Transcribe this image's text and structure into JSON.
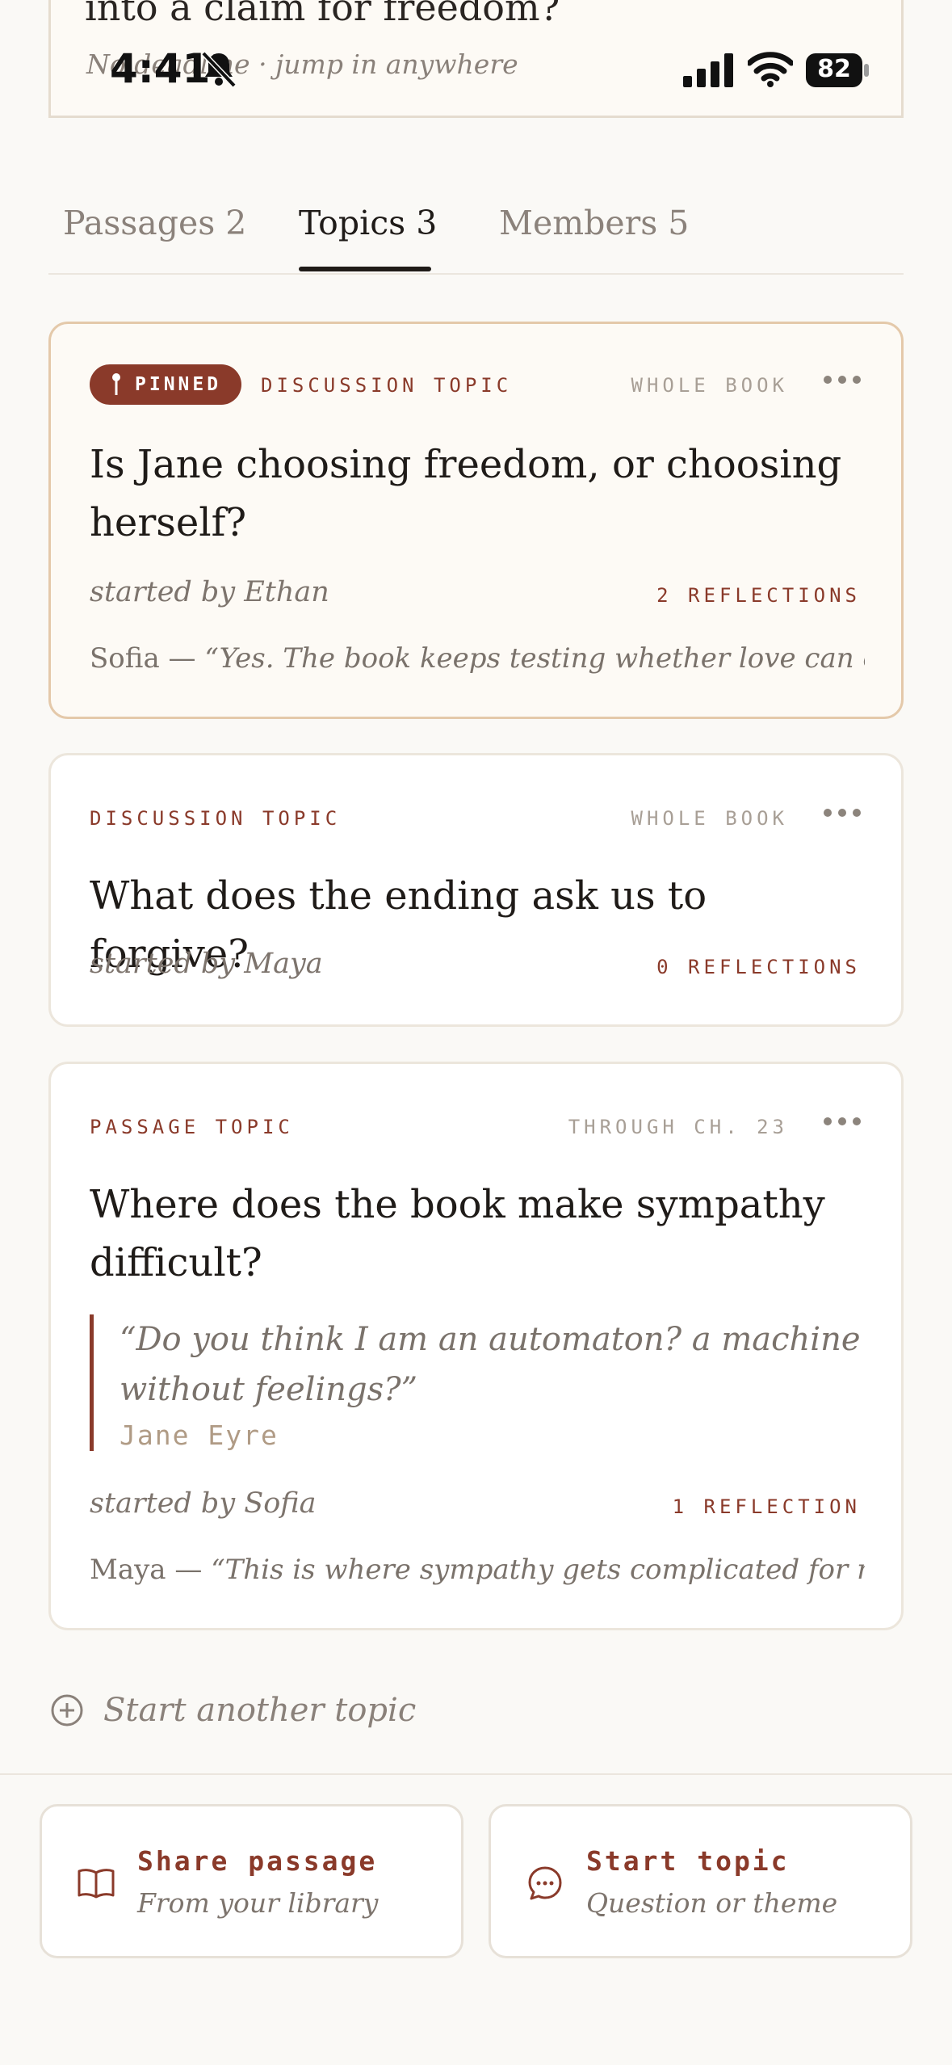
{
  "header_card": {
    "title": "into a claim for freedom?",
    "subtitle": "No deadline · jump in anywhere"
  },
  "status_bar": {
    "time": "4:41",
    "battery": "82"
  },
  "tabs": [
    {
      "label": "Passages 2",
      "active": false
    },
    {
      "label": "Topics 3",
      "active": true
    },
    {
      "label": "Members 5",
      "active": false
    }
  ],
  "topics": [
    {
      "pinned_label": "PINNED",
      "type": "DISCUSSION TOPIC",
      "scope": "WHOLE BOOK",
      "title": "Is Jane choosing freedom, or choosing herself?",
      "started_by": "started by Ethan",
      "reflections": "2 REFLECTIONS",
      "preview_author": "Sofia — ",
      "preview_text": "“Yes. The book keeps testing whether love can exist…"
    },
    {
      "type": "DISCUSSION TOPIC",
      "scope": "WHOLE BOOK",
      "title": "What does the ending ask us to forgive?",
      "started_by": "started by Maya",
      "reflections": "0 REFLECTIONS"
    },
    {
      "type": "PASSAGE TOPIC",
      "scope": "THROUGH CH. 23",
      "title": "Where does the book make sympathy difficult?",
      "quote": "“Do you think I am an automaton? a machine without feelings?”",
      "quote_source": "Jane Eyre",
      "started_by": "started by Sofia",
      "reflections": "1 REFLECTION",
      "preview_author": "Maya — ",
      "preview_text": "“This is where sympathy gets complicated for me:…"
    }
  ],
  "start_another": "Start another topic",
  "actions": [
    {
      "title": "Share passage",
      "subtitle": "From your library",
      "icon": "book-icon"
    },
    {
      "title": "Start topic",
      "subtitle": "Question or theme",
      "icon": "chat-bubble-icon"
    }
  ],
  "colors": {
    "accent": "#8a3a2a",
    "background": "#faf9f6",
    "pinned_border": "#e4c9aa"
  }
}
